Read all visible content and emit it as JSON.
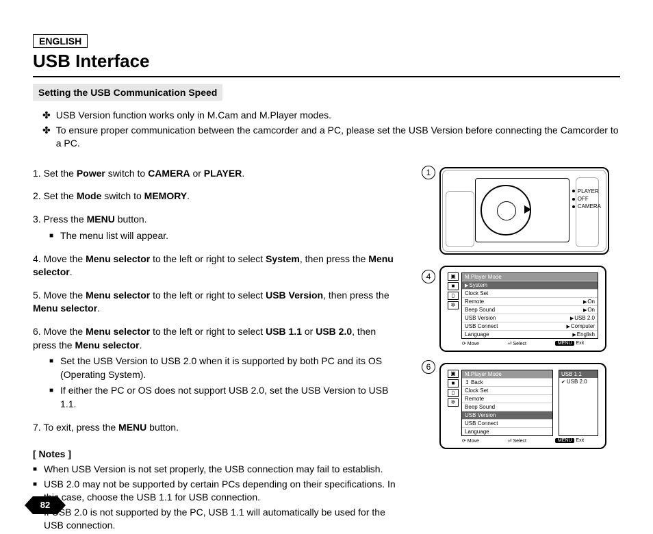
{
  "language_label": "ENGLISH",
  "title": "USB Interface",
  "section_heading": "Setting the USB Communication Speed",
  "intro": [
    "USB Version function works only in M.Cam and M.Player modes.",
    "To ensure proper communication between the camcorder and a PC, please set the USB Version before connecting the Camcorder to a PC."
  ],
  "steps": {
    "s1": {
      "num": "1.",
      "pre": "Set the ",
      "b1": "Power",
      "mid1": " switch to ",
      "b2": "CAMERA",
      "mid2": " or ",
      "b3": "PLAYER",
      "post": "."
    },
    "s2": {
      "num": "2.",
      "pre": "Set the ",
      "b1": "Mode",
      "mid1": " switch to ",
      "b2": "MEMORY",
      "post": "."
    },
    "s3": {
      "num": "3.",
      "pre": "Press the ",
      "b1": "MENU",
      "post": " button.",
      "sub1": "The menu list will appear."
    },
    "s4": {
      "num": "4.",
      "pre": "Move the ",
      "b1": "Menu selector",
      "mid1": " to the left or right to select ",
      "b2": "System",
      "mid2": ", then press the ",
      "b3": "Menu selector",
      "post": "."
    },
    "s5": {
      "num": "5.",
      "pre": "Move the ",
      "b1": "Menu selector",
      "mid1": " to the left or right to select ",
      "b2": "USB Version",
      "mid2": ", then press the ",
      "b3": "Menu selector",
      "post": "."
    },
    "s6": {
      "num": "6.",
      "pre": "Move the ",
      "b1": "Menu selector",
      "mid1": " to the left or right to select ",
      "b2": "USB 1.1",
      "mid2": " or ",
      "b3": "USB 2.0",
      "mid3": ", then press the ",
      "b4": "Menu selector",
      "post": ".",
      "sub1": "Set the USB Version to USB 2.0 when it is supported by both PC and its OS (Operating System).",
      "sub2": "If either the PC or OS does not support USB 2.0, set the USB Version to USB 1.1."
    },
    "s7": {
      "num": "7.",
      "pre": "To exit, press the ",
      "b1": "MENU",
      "post": " button."
    }
  },
  "notes_title": "[ Notes ]",
  "notes": [
    "When USB Version is not set properly, the USB connection may fail to establish.",
    "USB 2.0 may not be supported by certain PCs depending on their specifications. In this case, choose the USB 1.1 for USB connection.",
    "If USB 2.0 is not supported by the PC, USB 1.1 will automatically be used for the USB connection."
  ],
  "fig_labels": {
    "n1": "1",
    "n4": "4",
    "n6": "6"
  },
  "dial": {
    "player": "PLAYER",
    "off": "OFF",
    "camera": "CAMERA"
  },
  "menu4": {
    "mode": "M.Player Mode",
    "rows": [
      {
        "label": "System",
        "val": "",
        "hl": true,
        "tri": true
      },
      {
        "label": "Clock Set",
        "val": ""
      },
      {
        "label": "Remote",
        "val": "On",
        "tri": true
      },
      {
        "label": "Beep Sound",
        "val": "On",
        "tri": true
      },
      {
        "label": "USB Version",
        "val": "USB 2.0",
        "tri": true
      },
      {
        "label": "USB Connect",
        "val": "Computer",
        "tri": true
      },
      {
        "label": "Language",
        "val": "English",
        "tri": true
      }
    ],
    "footer": {
      "move": "Move",
      "select": "Select",
      "exit": "Exit",
      "menu": "MENU"
    }
  },
  "menu6": {
    "mode": "M.Player Mode",
    "back": "Back",
    "rows": [
      {
        "label": "Clock Set"
      },
      {
        "label": "Remote"
      },
      {
        "label": "Beep Sound"
      },
      {
        "label": "USB Version",
        "hl": true
      },
      {
        "label": "USB Connect"
      },
      {
        "label": "Language"
      }
    ],
    "options": [
      {
        "label": "USB 1.1",
        "sel": true
      },
      {
        "label": "USB 2.0",
        "chk": true
      }
    ],
    "footer": {
      "move": "Move",
      "select": "Select",
      "exit": "Exit",
      "menu": "MENU"
    }
  },
  "page_number": "82"
}
